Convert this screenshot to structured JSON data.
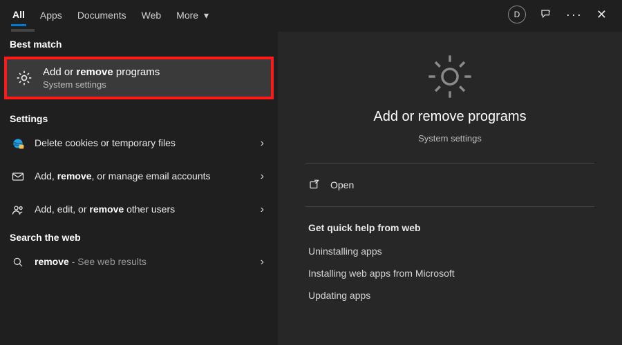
{
  "tabs": {
    "items": [
      {
        "label": "All",
        "active": true
      },
      {
        "label": "Apps",
        "active": false
      },
      {
        "label": "Documents",
        "active": false
      },
      {
        "label": "Web",
        "active": false
      },
      {
        "label": "More",
        "active": false,
        "hasChevron": true
      }
    ]
  },
  "topbar": {
    "avatar_initial": "D"
  },
  "left": {
    "section_best_match": "Best match",
    "best_match": {
      "title_pre": "Add or ",
      "title_bold": "remove",
      "title_post": " programs",
      "subtitle": "System settings"
    },
    "section_settings": "Settings",
    "settings_results": [
      {
        "icon": "globe-cookies-icon",
        "pre": "Delete cookies or temporary files",
        "bold": "",
        "post": ""
      },
      {
        "icon": "mail-icon",
        "pre": "Add, ",
        "bold": "remove",
        "post": ", or manage email accounts"
      },
      {
        "icon": "people-icon",
        "pre": "Add, edit, or ",
        "bold": "remove",
        "post": " other users"
      }
    ],
    "section_web": "Search the web",
    "web_result": {
      "icon": "search-icon",
      "pre": "",
      "bold": "remove",
      "post": "",
      "suffix_muted": " - See web results"
    }
  },
  "right": {
    "title": "Add or remove programs",
    "subtitle": "System settings",
    "open_label": "Open",
    "quick_help_title": "Get quick help from web",
    "quick_help_items": [
      "Uninstalling apps",
      "Installing web apps from Microsoft",
      "Updating apps"
    ]
  }
}
